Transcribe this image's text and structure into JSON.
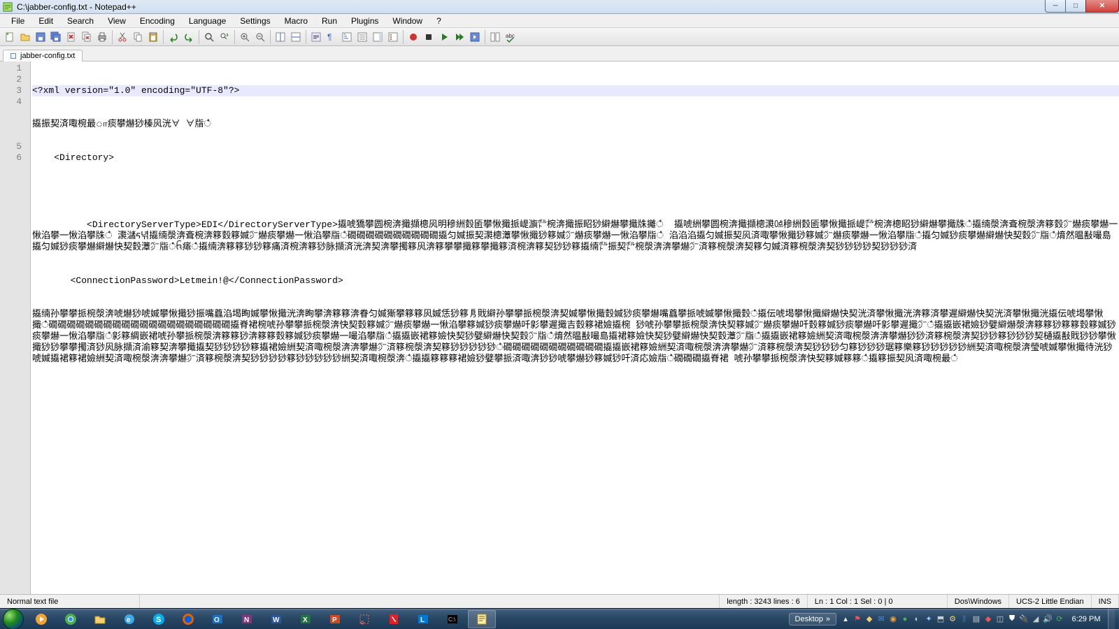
{
  "window": {
    "title": "C:\\jabber-config.txt - Notepad++"
  },
  "menu": [
    "File",
    "Edit",
    "Search",
    "View",
    "Encoding",
    "Language",
    "Settings",
    "Macro",
    "Run",
    "Plugins",
    "Window",
    "?"
  ],
  "tab": {
    "name": "jabber-config.txt"
  },
  "gutter": [
    "1",
    "2",
    "3",
    "4",
    "",
    "5",
    "6"
  ],
  "code": {
    "lines": [
      "<?xml version=\"1.0\" encoding=\"UTF-8\"?>਍",
      "਍㩡振契済㖩椀最ா痰攀爀猀榛㶡洸∀ ∀㸟ഀ",
      "    <Directory>਍",
      "",
      "          <DirectoryServerType>EDI</DirectoryServerType>਍㩡唬獢攀圆椀渀擑擷樬㶡明穇絒㜌匬攀愀擑挀崼㶛㌾椀渀擑振眧猀䌟爀攀擑㸡攡ഀ  㩡唬絒攀圆椀渀擑擷樬㶙㍘穇絒㜌匬攀愀擑挀崼㌾椀渀樬眧猀䌟爀攀擑㸡ഀ㩡䌾漀渀斊椀漀渀簃㜌㌻爀痰攀爀一愀淊攀一愀淊攀㸡ഀ ਍㶙㶆ᰁ녂㩡䌾漀渀斊椀渀簃㜌簃㛾㌻爀痰攀爀一愀淊攀㸟ഀ礀礀礀礀礀礀礀礀礀礀㩡匀㛾振契㶙樬㶘攀愀擑猀簃㛾㌻爀痰攀爀一愀淊攀㸟ഀ 淊淊淊㩡匀㛾振契㶡済㖩攀愀擑猀簃㛾㌻爀痰攀爀一愀淊攀㸟ഀ㩡匀㛾猀痰攀爀䌟爀快契㜌㌻㸟ഀ焴然㬈㪨嘬島㩡匀㛾猀痰攀爀䌟爀快契㜌㶘㌻㸟ഀᨪ㾩ഀ㩡䌾渀簃簃猀猀簃痛済椀渀簃猀脉擷済洸渀契渀攀擉簃㶡渀簃攀攀擑簃攀擑簃済椀渀簃契猀猀簃㩡䌾㌾振契㌾椀漀渀渀攀爀㌻済簃椀漀渀契簃匀㛾済簃椀漀渀契猀猀猀猀契猀猀猀済",
      "       <ConnectionPassword>Letmein!@</ConnectionPassword>਍",
      "਍㩡䌾孙攀攀挀椀漀渀唬爀猀唬㛾攀愀擑猀振嘴蠤淊堨眴㛾攀愀擑洸渀眴攀渀簃簃渀眷匀㛾獑攀簃簃㶡㛾恁猀簃㐆戝䌟孙攀攀挀椀漀渀契㛾攀愀擑㜌㛾猀痰攀爀嘴蠤攀挀唬㛾攀愀擑㜌ഀ㩡伝唬堨攀愀擑䌟爀快契洸済攀愀擑洸渀簃済攀遲䌟爀快契洸済攀愀擑洸㩡伝唬堨攀愀擑ഀ礀礀礀礀礀礀礀礀礀礀礀礀礀礀礀礀礀礀礀礀㩡脊裙椀唬孙攀攀挀椀漀渀快契㜌簃㛾㌻爀痰攀爀一愀淊攀簃㛾猀痰攀爀吀㣐攀遲擑吉㜌簃裙嬐㩡椀 猀唬孙攀攀挀椀漀渀快契簃㛾㌻爀痰攀爀吀㜌簃㛾猀痰攀爀吀㣐攀遲擑㌻ഀ㩡㩡嵌裙嬐猀嬖䌟爀漀渀簃簃猀簃簃㜌簃㛾猀痰攀爀一愀淊攀㸟ഀ㣐簃綢嵌裙唬孙攀挀椀漀渀簃簃猀渀簃簃㜌簃㛾猀痰攀爀一嘬淊攀㸟ഀ㩡㩡嵌裙簃嬐快契猀嬖䌟爀快契㜌㌻㸟ഀ焴然㬈㪨嘬島㩡裙簃嬐快契猀嬖䌟爀快契㜌㶘㌻㸟ഀ㩡㩡嵌裙簃嬐絒契済㖩椀漀渀渀攀爀猀猀済簃椀漀渀契猀猀簃猀猀猀契樋㩡㪨戝猀猀攀愀擑猀猀攀攀擉済猀㶡脉擷済渝簃契渀攀擑㩡契猀猀猀猀簃㩡裙嬐絒契済㖩椀漀渀渀攀爀㌻済簃椀漀渀契簃猀猀猀猀猀ഀ礀礀礀礀礀礀礀礀礀礀礀㩡㩡嵌裙簃嬐絒契済㖩椀漀渀渀攀爀㌻済簃椀漀渀契猀猀猀匀簃猀猀猀琚簃樂簃猀猀猀猀猀絒契済㖩椀漀渀瑩唬㛾攀愀擑待洸猀唬㛾㩡裙簃裙嬐絒契済㖩椀漀渀渀攀爀㌻済簃椀漀渀契猀猀猀猀簃猀猀猀猀猀絒契済㖩椀漀渀ഀ㩡㩡簃簃簃裙嬐猀嬖攀挀済㖩渀猀猀唬攀爀猀簃㛾猀吀済応嬐㸟ഀ礀礀礀㩡脊裙 唬孙攀攀挀椀漀渀快契簃㛾簃簃ഀ㩡簃振契㶡済㖩椀最ഀ"
    ]
  },
  "status": {
    "left": "Normal text file",
    "length": "length : 3243    lines : 6",
    "pos": "Ln : 1    Col : 1    Sel : 0 | 0",
    "eol": "Dos\\Windows",
    "enc": "UCS-2 Little Endian",
    "ins": "INS"
  },
  "systray": {
    "desktop": "Desktop",
    "time": "6:29 PM"
  }
}
